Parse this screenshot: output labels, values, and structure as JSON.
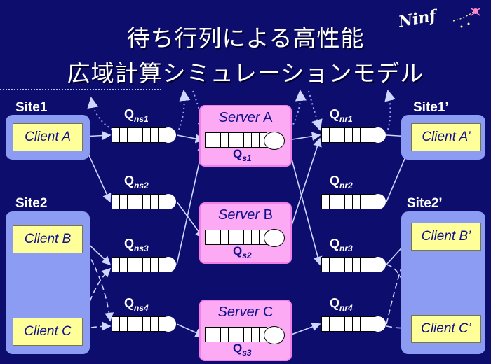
{
  "title": {
    "line1": "待ち行列による高性能",
    "line2": "広域計算シミュレーションモデル"
  },
  "logo": {
    "text": "Ninf"
  },
  "sites": {
    "site1": "Site1",
    "site2": "Site2",
    "site1p": "Site1’",
    "site2p": "Site2’"
  },
  "clients": {
    "a": "Client A",
    "b": "Client B",
    "c": "Client C",
    "a_prime": "Client A’",
    "b_prime": "Client B’",
    "c_prime": "Client C’"
  },
  "servers": [
    {
      "name": "Server",
      "letter": "A",
      "queue": "Q",
      "queue_sub": "s1"
    },
    {
      "name": "Server",
      "letter": "B",
      "queue": "Q",
      "queue_sub": "s2"
    },
    {
      "name": "Server",
      "letter": "C",
      "queue": "Q",
      "queue_sub": "s3"
    }
  ],
  "send_queues": [
    {
      "label": "Q",
      "sub": "ns1"
    },
    {
      "label": "Q",
      "sub": "ns2"
    },
    {
      "label": "Q",
      "sub": "ns3"
    },
    {
      "label": "Q",
      "sub": "ns4"
    }
  ],
  "recv_queues": [
    {
      "label": "Q",
      "sub": "nr1"
    },
    {
      "label": "Q",
      "sub": "nr2"
    },
    {
      "label": "Q",
      "sub": "nr3"
    },
    {
      "label": "Q",
      "sub": "nr4"
    }
  ],
  "colors": {
    "background": "#0d0d6e",
    "site_box": "#8c9cf2",
    "client_box": "#ffff99",
    "server_box": "#fbaaf3",
    "arrow": "#cfd6ff"
  }
}
